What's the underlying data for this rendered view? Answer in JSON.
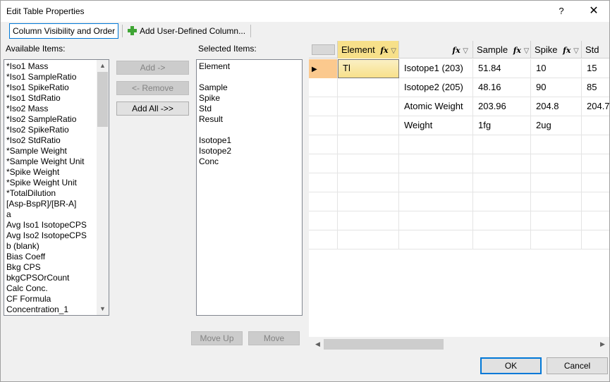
{
  "window": {
    "title": "Edit Table Properties",
    "help_label": "?",
    "close_label": "✕"
  },
  "toolbar": {
    "column_visibility_label": "Column Visibility and Order",
    "add_user_defined_label": "Add User-Defined Column..."
  },
  "available": {
    "label": "Available Items:",
    "items": [
      "*Iso1 Mass",
      "*Iso1 SampleRatio",
      "*Iso1 SpikeRatio",
      "*Iso1 StdRatio",
      "*Iso2 Mass",
      "*Iso2 SampleRatio",
      "*Iso2 SpikeRatio",
      "*Iso2 StdRatio",
      "*Sample Weight",
      "*Sample Weight Unit",
      "*Spike Weight",
      "*Spike Weight Unit",
      "*TotalDilution",
      "[Asp-BspR]/[BR-A]",
      "a",
      "Avg Iso1 IsotopeCPS",
      "Avg Iso2 IsotopeCPS",
      "b (blank)",
      "Bias Coeff",
      "Bkg CPS",
      "bkgCPSOrCount",
      "Calc Conc.",
      "CF Formula",
      "Concentration_1"
    ]
  },
  "buttons": {
    "add": "Add ->",
    "remove": "<- Remove",
    "add_all": "Add All ->>",
    "move_up": "Move Up",
    "move": "Move",
    "ok": "OK",
    "cancel": "Cancel"
  },
  "selected": {
    "label": "Selected Items:",
    "items": [
      "Element",
      "",
      "Sample",
      "Spike",
      "Std",
      "Result",
      "",
      "Isotope1",
      "Isotope2",
      "Conc"
    ]
  },
  "grid": {
    "columns": {
      "element": "Element",
      "sample": "Sample",
      "spike": "Spike",
      "std": "Std"
    },
    "rows": [
      {
        "element": "Tl",
        "label": "Isotope1 (203)",
        "sample": "51.84",
        "spike": "10",
        "std": "15"
      },
      {
        "element": "",
        "label": "Isotope2 (205)",
        "sample": "48.16",
        "spike": "90",
        "std": "85"
      },
      {
        "element": "",
        "label": "Atomic Weight",
        "sample": "203.96",
        "spike": "204.8",
        "std": "204.7"
      },
      {
        "element": "",
        "label": "Weight",
        "sample": "1fg",
        "spike": "2ug",
        "std": ""
      }
    ],
    "empty_rows": 6
  },
  "colors": {
    "selected_cell": "#f7e08a",
    "row_indicator": "#fbc98e",
    "accent_border": "#0078d7"
  }
}
